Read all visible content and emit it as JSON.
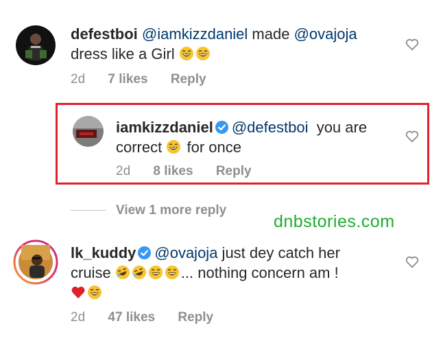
{
  "comments": [
    {
      "username": "defestboi",
      "text_parts": [
        "@iamkizzdaniel",
        " made ",
        "@ovajoja"
      ],
      "line2": "dress like a Girl",
      "time": "2d",
      "likes": "7 likes",
      "reply": "Reply"
    },
    {
      "username": "iamkizzdaniel",
      "verified": true,
      "mention": "@defestboi",
      "line1_rest": "  you are",
      "line2_a": "correct",
      "line2_b": " for once",
      "time": "2d",
      "likes": "8 likes",
      "reply": "Reply"
    },
    {
      "username": "lk_kuddy",
      "verified": true,
      "mention": "@ovajoja",
      "line1_rest": " just dey catch her",
      "line2_a": "cruise",
      "line2_b": "... nothing concern am !",
      "time": "2d",
      "likes": "47 likes",
      "reply": "Reply"
    }
  ],
  "view_more": "View 1 more reply",
  "watermark": "dnbstories.com",
  "colors": {
    "highlight_border": "#e0202a",
    "watermark": "#1cae2c",
    "mention": "#00376b",
    "verified": "#3897f0",
    "muted": "#8e8e8e"
  }
}
